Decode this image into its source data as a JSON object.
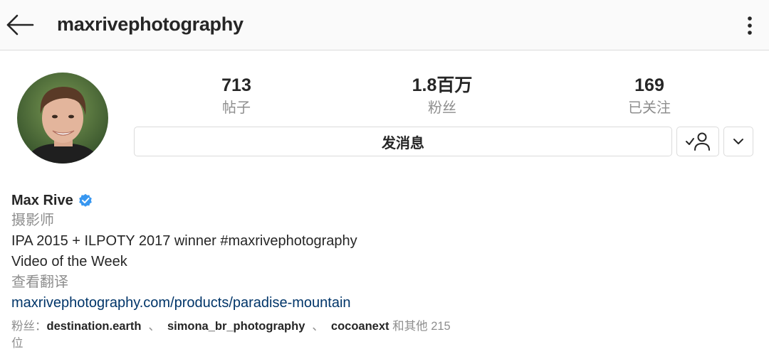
{
  "header": {
    "username": "maxrivephotography",
    "back_icon": "arrow-left-icon",
    "more_icon": "more-vertical-icon"
  },
  "stats": {
    "posts": {
      "count": "713",
      "label": "帖子"
    },
    "followers": {
      "count": "1.8百万",
      "label": "粉丝"
    },
    "following": {
      "count": "169",
      "label": "已关注"
    }
  },
  "actions": {
    "message_label": "发消息",
    "following_icon": "user-check-icon",
    "dropdown_icon": "chevron-down-icon"
  },
  "bio": {
    "name": "Max Rive",
    "verified_icon": "verified-badge-icon",
    "category": "摄影师",
    "line1": "IPA 2015 + ILPOTY 2017 winner #maxrivephotography",
    "line2": "Video of the Week",
    "translate": "查看翻译",
    "website": "maxrivephotography.com/products/paradise-mountain"
  },
  "followed_by": {
    "prefix": "粉丝：",
    "accounts": [
      "destination.earth",
      "simona_br_photography",
      "cocoanext"
    ],
    "separator": "、",
    "suffix": "和其他 215 位"
  },
  "colors": {
    "text": "#262626",
    "secondary": "#8e8e8e",
    "link": "#003569",
    "verified": "#3897f0",
    "border": "#dbdbdb",
    "topbar_bg": "#fafafa"
  }
}
